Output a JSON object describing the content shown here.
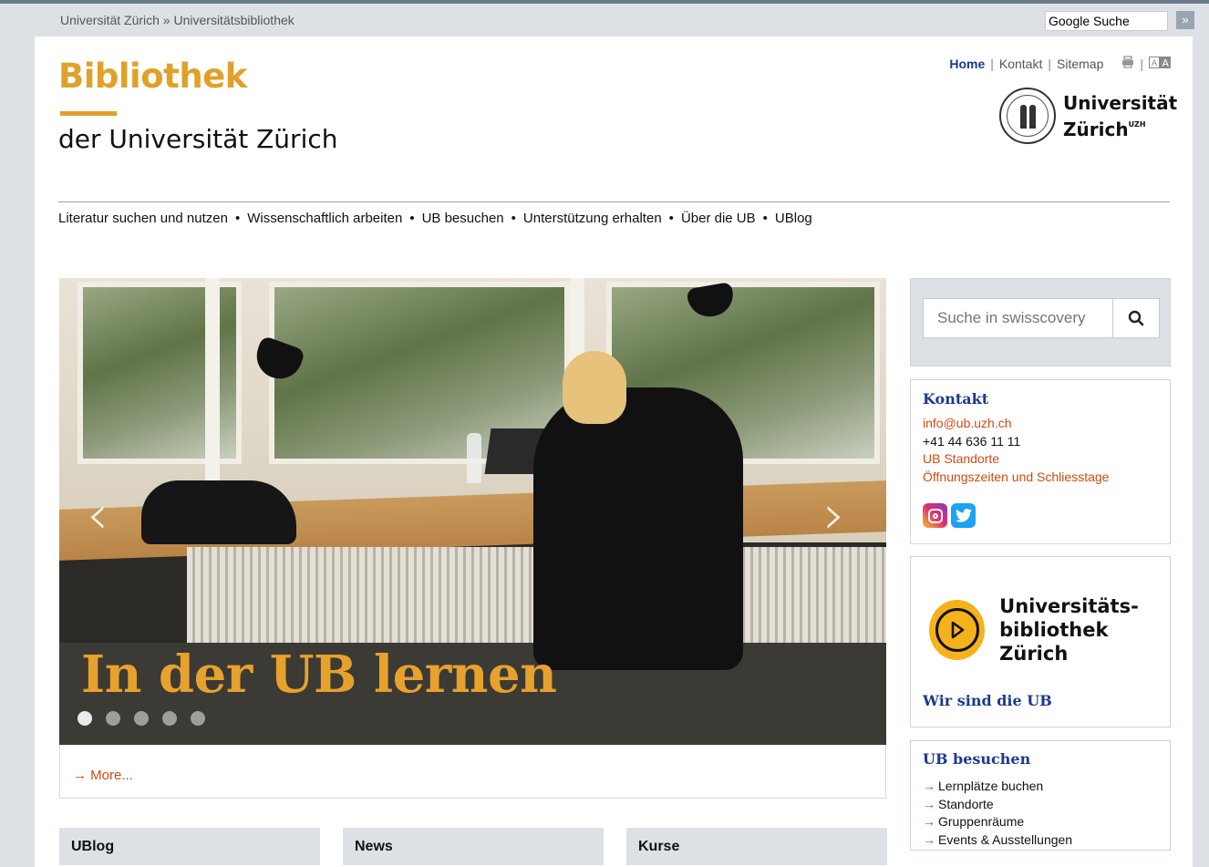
{
  "topbar": {
    "breadcrumb": "Universität Zürich » Universitätsbibliothek",
    "google_search_value": "Google Suche",
    "google_search_button": "»"
  },
  "header": {
    "brand_line1": "Bibliothek",
    "brand_line2": "der Universität Zürich",
    "util": {
      "home": "Home",
      "contact": "Kontakt",
      "sitemap": "Sitemap"
    },
    "uzh_logo": {
      "line1": "Universität",
      "line2": "Zürich",
      "sup": "UZH"
    },
    "brand_color": "#e0a12a",
    "link_color": "#1a3a8f"
  },
  "nav": {
    "items": [
      "Literatur suchen und nutzen",
      "Wissenschaftlich arbeiten",
      "UB besuchen",
      "Unterstützung erhalten",
      "Über die UB",
      "UBlog"
    ]
  },
  "slider": {
    "caption": "In der UB lernen",
    "more_link": "→ More...",
    "dots_total": 5,
    "active_dot": 1,
    "prev_icon": "chevron-left-icon",
    "next_icon": "chevron-right-icon"
  },
  "columns": {
    "col1": "UBlog",
    "col2": "News",
    "col3": "Kurse"
  },
  "sidebar": {
    "search_placeholder": "Suche in swisscovery",
    "contact": {
      "title": "Kontakt",
      "email": "info@ub.uzh.ch",
      "phone": "+41 44 636 11 11",
      "locations": "UB Standorte",
      "hours": "Öffnungszeiten und Schliesstage"
    },
    "video": {
      "title_line1": "Universitäts-",
      "title_line2": "bibliothek Zürich",
      "link": "Wir sind die UB"
    },
    "visit": {
      "title": "UB besuchen",
      "items": [
        "Lernplätze buchen",
        "Standorte",
        "Gruppenräume",
        "Events & Ausstellungen"
      ]
    }
  }
}
